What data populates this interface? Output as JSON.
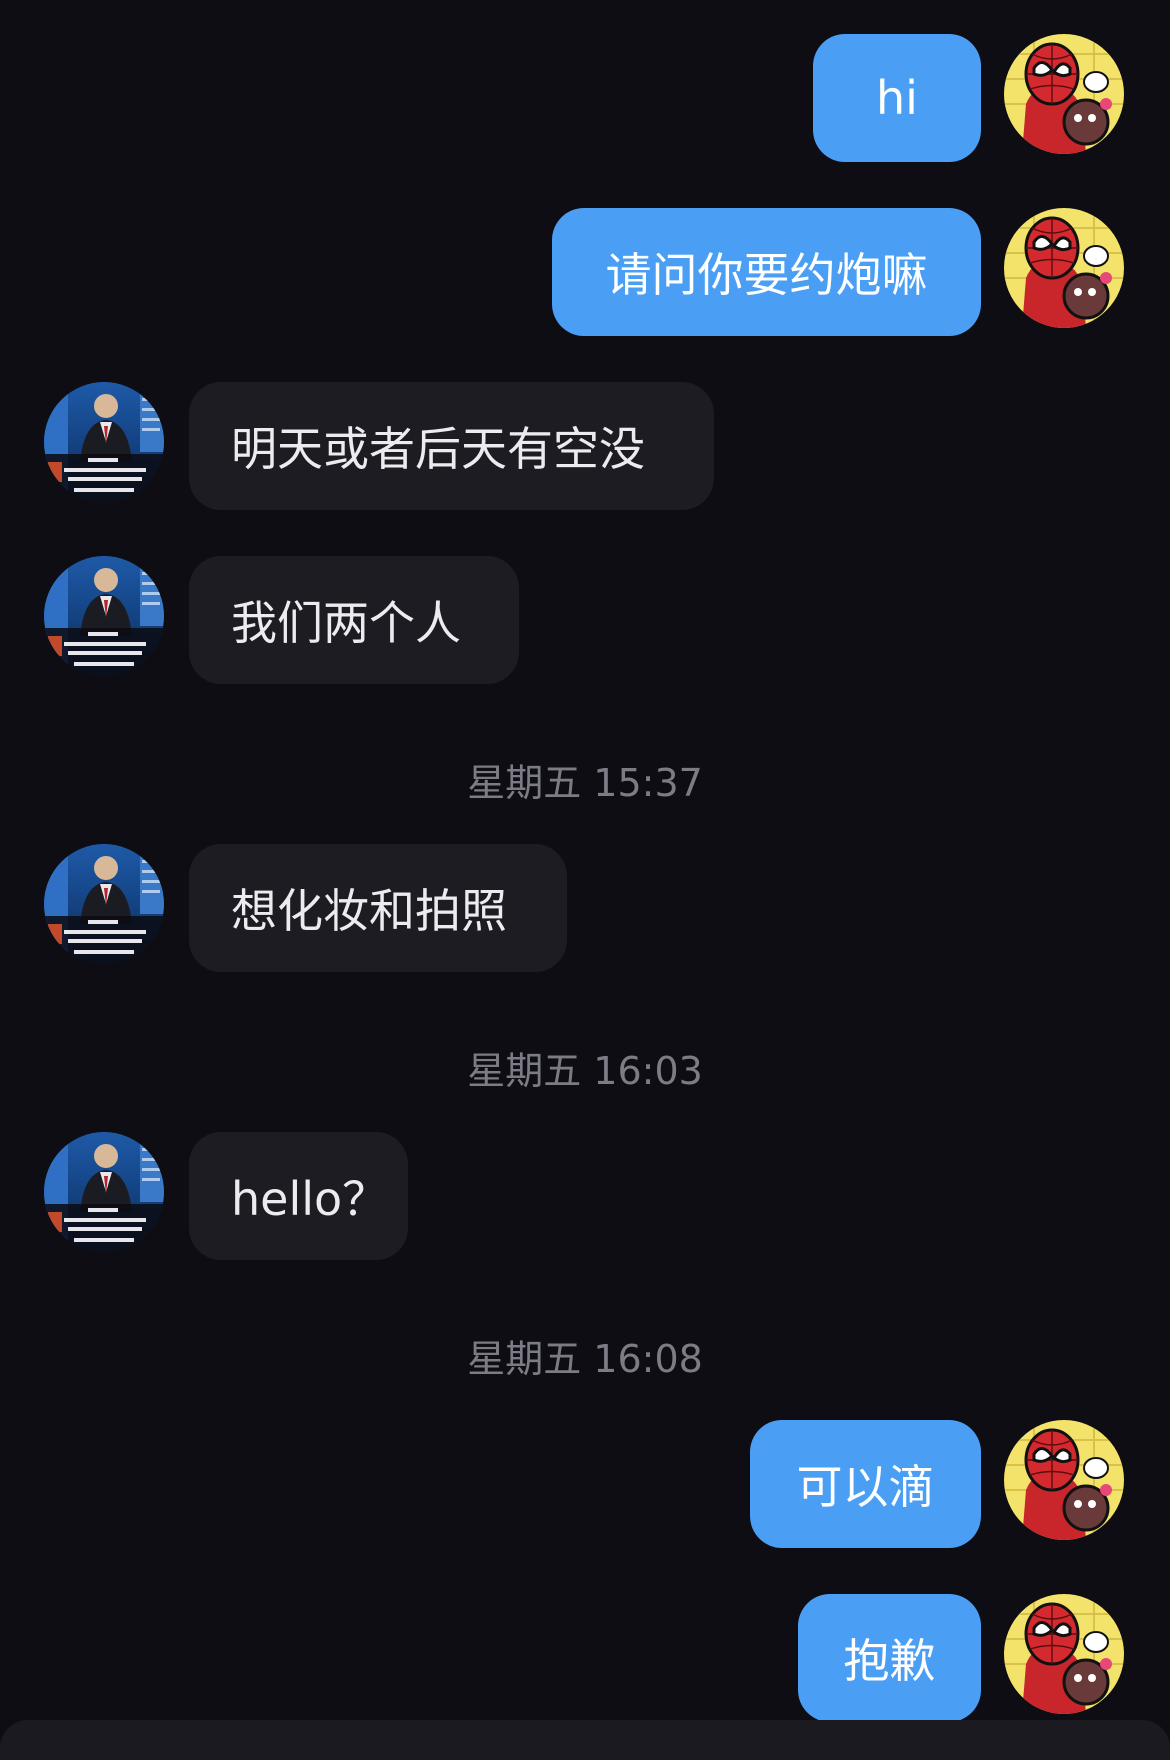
{
  "messages": [
    {
      "dir": "out",
      "text": "hi"
    },
    {
      "dir": "out",
      "text": "请问你要约炮嘛"
    },
    {
      "dir": "in",
      "text": "明天或者后天有空没"
    },
    {
      "dir": "in",
      "text": "我们两个人"
    },
    {
      "timestamp": "星期五 15:37"
    },
    {
      "dir": "in",
      "text": "想化妆和拍照"
    },
    {
      "timestamp": "星期五 16:03"
    },
    {
      "dir": "in",
      "text": "hello？"
    },
    {
      "timestamp": "星期五 16:08"
    },
    {
      "dir": "out",
      "text": "可以滴"
    },
    {
      "dir": "out",
      "text": "抱歉"
    }
  ],
  "colors": {
    "background": "#0d0d13",
    "outgoing_bubble": "#4a9ff5",
    "incoming_bubble": "#1c1c22",
    "timestamp_text": "#7c7c86"
  },
  "icons": {
    "self_avatar": "spiderman-avatar-icon",
    "contact_avatar": "contact-avatar-icon"
  }
}
